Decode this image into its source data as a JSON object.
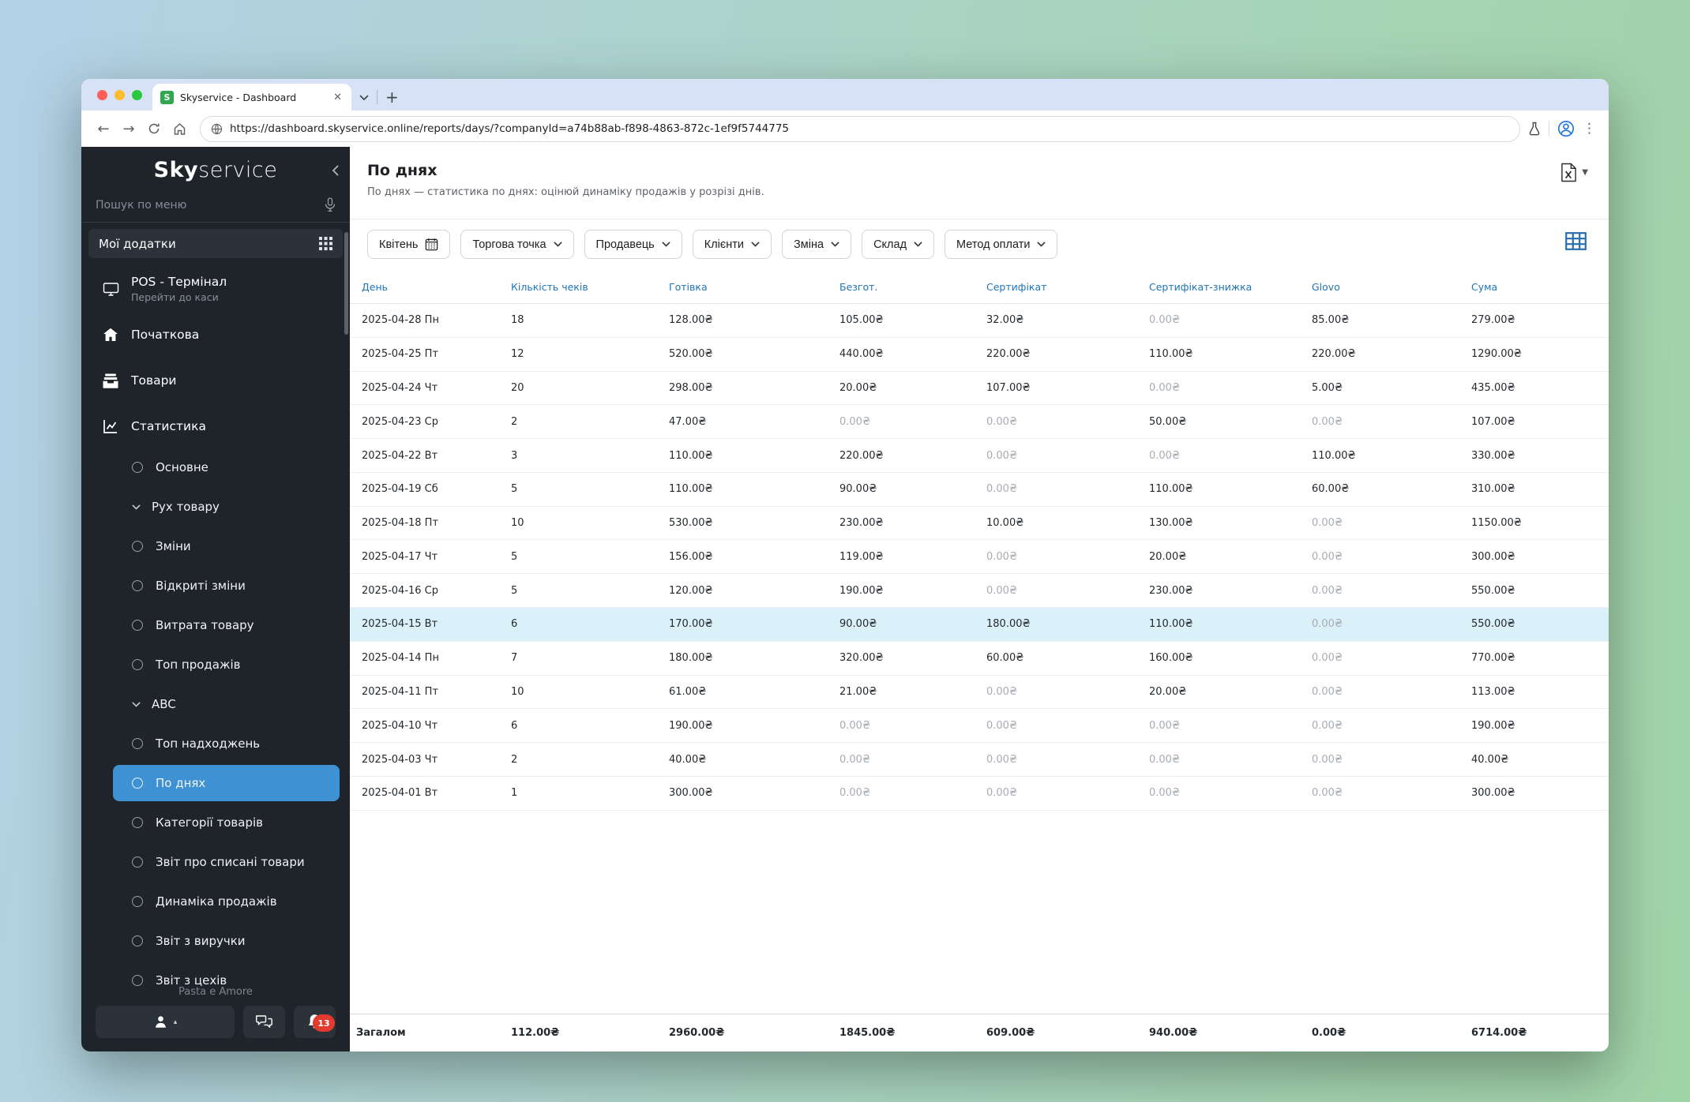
{
  "browser": {
    "tab_title": "Skyservice - Dashboard",
    "favicon_letter": "S",
    "url": "https://dashboard.skyservice.online/reports/days/?companyId=a74b88ab-f898-4863-872c-1ef9f5744775"
  },
  "sidebar": {
    "logo_bold": "Sky",
    "logo_light": "service",
    "search_placeholder": "Пошук по меню",
    "apps_label": "Мої додатки",
    "items": [
      {
        "name": "pos-terminal",
        "label": "POS - Термінал",
        "sublabel": "Перейти до каси"
      },
      {
        "name": "home",
        "label": "Початкова"
      },
      {
        "name": "goods",
        "label": "Товари"
      },
      {
        "name": "statistics",
        "label": "Статистика"
      }
    ],
    "subitems": [
      {
        "name": "main",
        "label": "Основне",
        "type": "radio",
        "active": false
      },
      {
        "name": "goods-movement",
        "label": "Рух товару",
        "type": "expand",
        "active": false
      },
      {
        "name": "shifts",
        "label": "Зміни",
        "type": "radio",
        "active": false
      },
      {
        "name": "open-shifts",
        "label": "Відкриті зміни",
        "type": "radio",
        "active": false
      },
      {
        "name": "goods-expense",
        "label": "Витрата товару",
        "type": "radio",
        "active": false
      },
      {
        "name": "top-sales",
        "label": "Топ продажів",
        "type": "radio",
        "active": false
      },
      {
        "name": "abc",
        "label": "ABC",
        "type": "expand",
        "active": false
      },
      {
        "name": "top-receipts",
        "label": "Топ надходжень",
        "type": "radio",
        "active": false
      },
      {
        "name": "by-days",
        "label": "По днях",
        "type": "radio",
        "active": true
      },
      {
        "name": "goods-categories",
        "label": "Категорії товарів",
        "type": "radio",
        "active": false
      },
      {
        "name": "written-off-report",
        "label": "Звіт про списані товари",
        "type": "radio",
        "active": false
      },
      {
        "name": "sales-dynamics",
        "label": "Динаміка продажів",
        "type": "radio",
        "active": false
      },
      {
        "name": "revenue-report",
        "label": "Звіт з виручки",
        "type": "radio",
        "active": false
      },
      {
        "name": "workshops-report",
        "label": "Звіт з цехів",
        "type": "radio",
        "active": false
      }
    ],
    "company": "Pasta e Amore",
    "notification_count": "13"
  },
  "main": {
    "title": "По днях",
    "subtitle": "По днях — статистика по днях: оцінюй динаміку продажів у розрізі днів.",
    "filters": [
      {
        "name": "month",
        "label": "Квітень",
        "icon": "calendar"
      },
      {
        "name": "outlet",
        "label": "Торгова точка",
        "icon": "chevron"
      },
      {
        "name": "seller",
        "label": "Продавець",
        "icon": "chevron"
      },
      {
        "name": "clients",
        "label": "Клієнти",
        "icon": "chevron"
      },
      {
        "name": "shift",
        "label": "Зміна",
        "icon": "chevron"
      },
      {
        "name": "warehouse",
        "label": "Склад",
        "icon": "chevron"
      },
      {
        "name": "payment-method",
        "label": "Метод оплати",
        "icon": "chevron"
      }
    ]
  },
  "table": {
    "columns": [
      "День",
      "Кількість чеків",
      "Готівка",
      "Безгот.",
      "Сертифікат",
      "Сертифікат-знижка",
      "Glovo",
      "Сума"
    ],
    "rows": [
      [
        "2025-04-28 Пн",
        "18",
        "128.00₴",
        "105.00₴",
        "32.00₴",
        "0.00₴",
        "85.00₴",
        "279.00₴"
      ],
      [
        "2025-04-25 Пт",
        "12",
        "520.00₴",
        "440.00₴",
        "220.00₴",
        "110.00₴",
        "220.00₴",
        "1290.00₴"
      ],
      [
        "2025-04-24 Чт",
        "20",
        "298.00₴",
        "20.00₴",
        "107.00₴",
        "0.00₴",
        "5.00₴",
        "435.00₴"
      ],
      [
        "2025-04-23 Ср",
        "2",
        "47.00₴",
        "0.00₴",
        "0.00₴",
        "50.00₴",
        "0.00₴",
        "107.00₴"
      ],
      [
        "2025-04-22 Вт",
        "3",
        "110.00₴",
        "220.00₴",
        "0.00₴",
        "0.00₴",
        "110.00₴",
        "330.00₴"
      ],
      [
        "2025-04-19 Сб",
        "5",
        "110.00₴",
        "90.00₴",
        "0.00₴",
        "110.00₴",
        "60.00₴",
        "310.00₴"
      ],
      [
        "2025-04-18 Пт",
        "10",
        "530.00₴",
        "230.00₴",
        "10.00₴",
        "130.00₴",
        "0.00₴",
        "1150.00₴"
      ],
      [
        "2025-04-17 Чт",
        "5",
        "156.00₴",
        "119.00₴",
        "0.00₴",
        "20.00₴",
        "0.00₴",
        "300.00₴"
      ],
      [
        "2025-04-16 Ср",
        "5",
        "120.00₴",
        "190.00₴",
        "0.00₴",
        "230.00₴",
        "0.00₴",
        "550.00₴"
      ],
      [
        "2025-04-15 Вт",
        "6",
        "170.00₴",
        "90.00₴",
        "180.00₴",
        "110.00₴",
        "0.00₴",
        "550.00₴"
      ],
      [
        "2025-04-14 Пн",
        "7",
        "180.00₴",
        "320.00₴",
        "60.00₴",
        "160.00₴",
        "0.00₴",
        "770.00₴"
      ],
      [
        "2025-04-11 Пт",
        "10",
        "61.00₴",
        "21.00₴",
        "0.00₴",
        "20.00₴",
        "0.00₴",
        "113.00₴"
      ],
      [
        "2025-04-10 Чт",
        "6",
        "190.00₴",
        "0.00₴",
        "0.00₴",
        "0.00₴",
        "0.00₴",
        "190.00₴"
      ],
      [
        "2025-04-03 Чт",
        "2",
        "40.00₴",
        "0.00₴",
        "0.00₴",
        "0.00₴",
        "0.00₴",
        "40.00₴"
      ],
      [
        "2025-04-01 Вт",
        "1",
        "300.00₴",
        "0.00₴",
        "0.00₴",
        "0.00₴",
        "0.00₴",
        "300.00₴"
      ]
    ],
    "highlighted_row": 9,
    "total_label": "Загалом",
    "totals": [
      "112.00₴",
      "2960.00₴",
      "1845.00₴",
      "609.00₴",
      "940.00₴",
      "0.00₴",
      "6714.00₴"
    ]
  }
}
